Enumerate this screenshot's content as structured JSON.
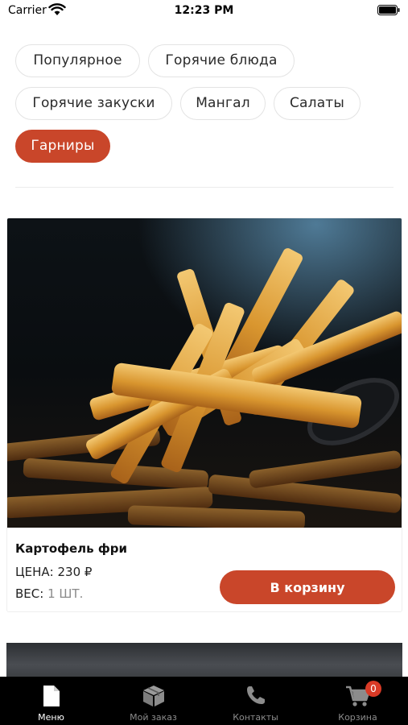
{
  "status_bar": {
    "carrier": "Carrier",
    "time": "12:23 PM"
  },
  "categories": [
    {
      "label": "Популярное",
      "active": false
    },
    {
      "label": "Горячие блюда",
      "active": false
    },
    {
      "label": "Горячие закуски",
      "active": false
    },
    {
      "label": "Мангал",
      "active": false
    },
    {
      "label": "Салаты",
      "active": false
    },
    {
      "label": "Гарниры",
      "active": true
    }
  ],
  "product": {
    "name": "Картофель фри",
    "price_label": "ЦЕНА:",
    "price_value": "230 ₽",
    "weight_label": "ВЕС:",
    "weight_value": "1 ШТ.",
    "add_button": "В корзину"
  },
  "tabbar": {
    "items": [
      {
        "label": "Меню",
        "icon": "document-icon",
        "active": true
      },
      {
        "label": "Мой заказ",
        "icon": "box-icon",
        "active": false
      },
      {
        "label": "Контакты",
        "icon": "phone-icon",
        "active": false
      },
      {
        "label": "Корзина",
        "icon": "cart-icon",
        "active": false
      }
    ],
    "cart_badge": "0"
  },
  "colors": {
    "accent": "#c9462a",
    "tabbar_bg": "#000000",
    "badge": "#d93a26"
  }
}
